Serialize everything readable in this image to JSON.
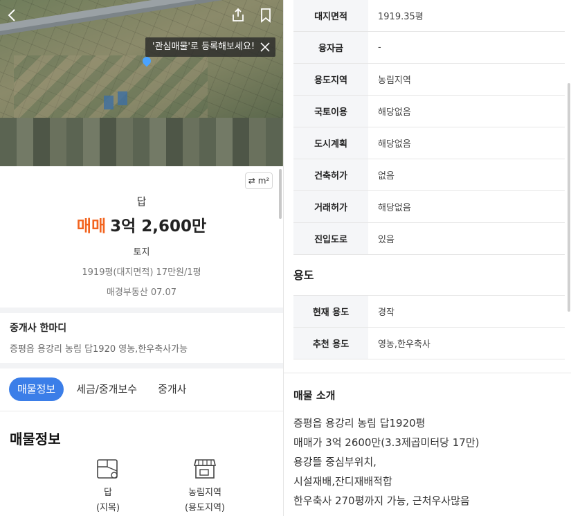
{
  "map": {
    "tooltip": "'관심매물'로 등록해보세요!",
    "back_icon": "chevron-left-icon",
    "share_icon": "share-icon",
    "bookmark_icon": "bookmark-icon",
    "close_icon": "close-icon"
  },
  "unit_toggle": {
    "label": "m²",
    "icon": "swap-icon"
  },
  "summary": {
    "land_type": "답",
    "deal_type": "매매",
    "price": "3억 2,600만",
    "category": "토지",
    "area_price": "1919평(대지면적)  17만원/1평",
    "agency_date": "매경부동산 07.07"
  },
  "broker_note": {
    "title": "중개사 한마디",
    "text": "증평읍 용강리 농림 답1920 영농,한우축사가능"
  },
  "tabs": [
    "매물정보",
    "세금/중개보수",
    "중개사"
  ],
  "active_tab": "매물정보",
  "info_section": {
    "title": "매물정보",
    "items": [
      {
        "icon": "land-map-icon",
        "label": "답",
        "sub": "(지목)"
      },
      {
        "icon": "store-icon",
        "label": "농림지역",
        "sub": "(용도지역)"
      }
    ]
  },
  "detail_table": [
    {
      "key": "대지면적",
      "value": "1919.35평"
    },
    {
      "key": "융자금",
      "value": "-"
    },
    {
      "key": "용도지역",
      "value": "농림지역"
    },
    {
      "key": "국토이용",
      "value": "해당없음"
    },
    {
      "key": "도시계획",
      "value": "해당없음"
    },
    {
      "key": "건축허가",
      "value": "없음"
    },
    {
      "key": "거래허가",
      "value": "해당없음"
    },
    {
      "key": "진입도로",
      "value": "있음"
    }
  ],
  "usage": {
    "title": "용도",
    "rows": [
      {
        "key": "현재 용도",
        "value": "경작"
      },
      {
        "key": "추천 용도",
        "value": "영농,한우축사"
      }
    ]
  },
  "intro": {
    "title": "매물 소개",
    "lines": [
      "증평읍 용강리 농림 답1920평",
      "매매가 3억 2600만(3.3제곱미터당 17만)",
      "용강뜰 중심부위치,",
      "시설재배,잔디재배적합",
      "한우축사 270평까지 가능, 근처우사많음"
    ]
  },
  "colors": {
    "accent": "#3b7ee8",
    "deal": "#f2641f",
    "header_cell": "#f5f6f8"
  }
}
